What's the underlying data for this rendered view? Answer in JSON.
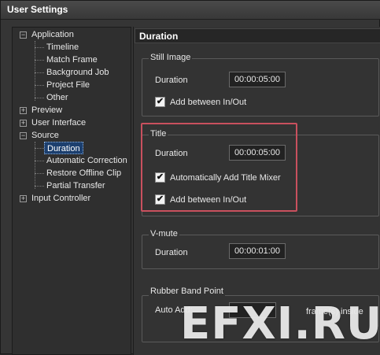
{
  "window": {
    "title": "User Settings"
  },
  "tree": {
    "application": "Application",
    "timeline": "Timeline",
    "match_frame": "Match Frame",
    "background_job": "Background Job",
    "project_file": "Project File",
    "other": "Other",
    "preview": "Preview",
    "user_interface": "User Interface",
    "source": "Source",
    "duration": "Duration",
    "automatic_correction": "Automatic Correction",
    "restore_offline_clip": "Restore Offline Clip",
    "partial_transfer": "Partial Transfer",
    "input_controller": "Input Controller",
    "expand_symbol": "+",
    "collapse_symbol": "−"
  },
  "panel": {
    "header": "Duration"
  },
  "still_image": {
    "title": "Still Image",
    "duration_label": "Duration",
    "duration_value": "00:00:05:00",
    "add_between_label": "Add between In/Out",
    "add_between_checked": true
  },
  "title_group": {
    "title": "Title",
    "duration_label": "Duration",
    "duration_value": "00:00:05:00",
    "auto_mixer_label": "Automatically Add Title Mixer",
    "auto_mixer_checked": true,
    "add_between_label": "Add between In/Out",
    "add_between_checked": true
  },
  "vmute": {
    "title": "V-mute",
    "duration_label": "Duration",
    "duration_value": "00:00:01:00"
  },
  "rubber_band": {
    "title": "Rubber Band Point",
    "auto_add_label": "Auto Add:",
    "suffix_label": "frame(s) inside"
  },
  "check_glyph": "✔",
  "watermark": "EFXI.RU",
  "colors": {
    "highlight": "#c9505e",
    "selection": "#1c3f6e"
  }
}
